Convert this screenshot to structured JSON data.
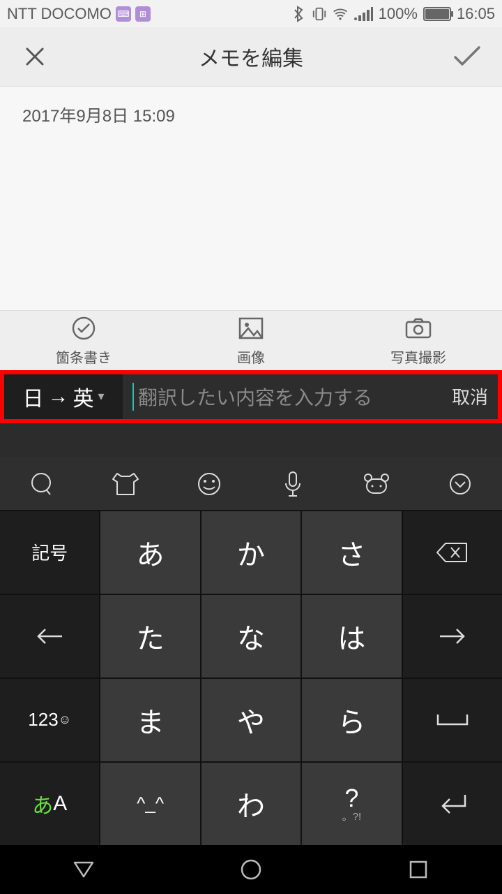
{
  "status": {
    "carrier": "NTT DOCOMO",
    "battery_pct": "100%",
    "time": "16:05"
  },
  "header": {
    "title": "メモを編集"
  },
  "memo": {
    "timestamp": "2017年9月8日 15:09"
  },
  "attach": {
    "bullet": "箇条書き",
    "image": "画像",
    "camera": "写真撮影"
  },
  "translate": {
    "from": "日",
    "to": "英",
    "placeholder": "翻訳したい内容を入力する",
    "cancel": "取消"
  },
  "keyboard": {
    "rows": [
      [
        "記号",
        "あ",
        "か",
        "さ",
        "⌫"
      ],
      [
        "←",
        "た",
        "な",
        "は",
        "→"
      ],
      [
        "123☺",
        "ま",
        "や",
        "ら",
        "␣"
      ],
      [
        "あA",
        "^_^",
        "わ",
        "?",
        "⏎"
      ]
    ],
    "q_sub": "。?!"
  }
}
